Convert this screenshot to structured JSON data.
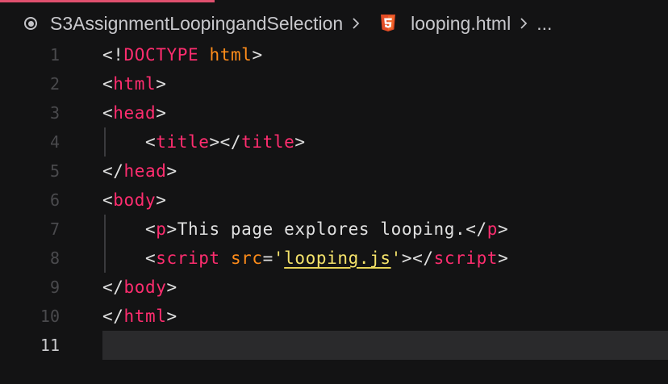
{
  "breadcrumb": {
    "folder": "S3AssignmentLoopingandSelection",
    "file": "looping.html",
    "more": "..."
  },
  "editor": {
    "current_line": 11,
    "lines": [
      {
        "number": "1",
        "tokens": [
          [
            "p",
            "<!"
          ],
          [
            "t",
            "DOCTYPE"
          ],
          [
            "p",
            " "
          ],
          [
            "a",
            "html"
          ],
          [
            "p",
            ">"
          ]
        ]
      },
      {
        "number": "2",
        "tokens": [
          [
            "p",
            "<"
          ],
          [
            "t",
            "html"
          ],
          [
            "p",
            ">"
          ]
        ]
      },
      {
        "number": "3",
        "tokens": [
          [
            "p",
            "<"
          ],
          [
            "t",
            "head"
          ],
          [
            "p",
            ">"
          ]
        ]
      },
      {
        "number": "4",
        "tokens": [
          [
            "p",
            "    <"
          ],
          [
            "t",
            "title"
          ],
          [
            "p",
            "></"
          ],
          [
            "t",
            "title"
          ],
          [
            "p",
            ">"
          ]
        ]
      },
      {
        "number": "5",
        "tokens": [
          [
            "p",
            "</"
          ],
          [
            "t",
            "head"
          ],
          [
            "p",
            ">"
          ]
        ]
      },
      {
        "number": "6",
        "tokens": [
          [
            "p",
            "<"
          ],
          [
            "t",
            "body"
          ],
          [
            "p",
            ">"
          ]
        ]
      },
      {
        "number": "7",
        "tokens": [
          [
            "p",
            "    <"
          ],
          [
            "t",
            "p"
          ],
          [
            "p",
            ">This page explores looping.</"
          ],
          [
            "t",
            "p"
          ],
          [
            "p",
            ">"
          ]
        ]
      },
      {
        "number": "8",
        "tokens": [
          [
            "p",
            "    <"
          ],
          [
            "t",
            "script"
          ],
          [
            "p",
            " "
          ],
          [
            "a",
            "src"
          ],
          [
            "p",
            "="
          ],
          [
            "s",
            "'"
          ],
          [
            "sl",
            "looping.js"
          ],
          [
            "s",
            "'"
          ],
          [
            "p",
            "></"
          ],
          [
            "t",
            "script"
          ],
          [
            "p",
            ">"
          ]
        ]
      },
      {
        "number": "9",
        "tokens": [
          [
            "p",
            "</"
          ],
          [
            "t",
            "body"
          ],
          [
            "p",
            ">"
          ]
        ]
      },
      {
        "number": "10",
        "tokens": [
          [
            "p",
            "</"
          ],
          [
            "t",
            "html"
          ],
          [
            "p",
            ">"
          ]
        ]
      },
      {
        "number": "11",
        "tokens": []
      }
    ]
  },
  "colors": {
    "background": "#131314",
    "tag": "#ff2d6f",
    "attribute": "#ff8c1a",
    "string": "#f5e36b",
    "text": "#e0e0e0",
    "line_number": "#4a4a4d",
    "tab_accent": "#e0506e",
    "html5_icon": "#e44d26"
  },
  "icons": {
    "radio": "radio-circle-icon",
    "separator": "chevron-right-icon",
    "file_type": "html5-icon"
  }
}
